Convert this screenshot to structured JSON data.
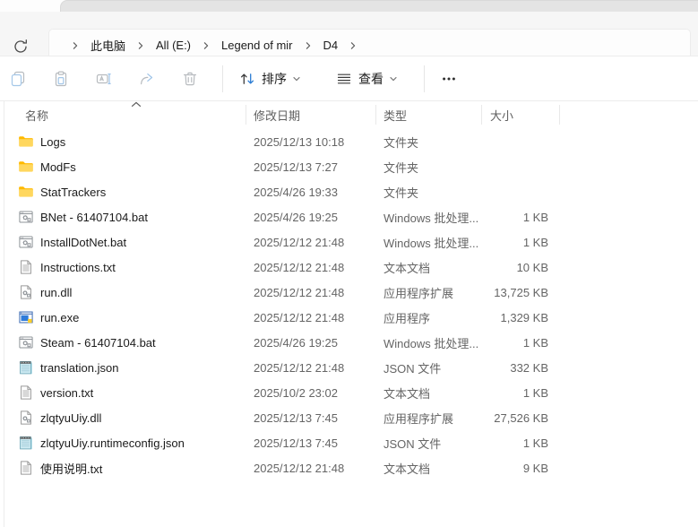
{
  "address_bar": {
    "refresh_icon": "refresh-icon",
    "breadcrumb": {
      "device_icon": "monitor-icon",
      "items": [
        "此电脑",
        "All (E:)",
        "Legend of mir",
        "D4"
      ]
    }
  },
  "toolbar": {
    "icon_buttons": [
      {
        "name": "copy",
        "icon": "copy-icon"
      },
      {
        "name": "paste",
        "icon": "paste-icon"
      },
      {
        "name": "rename",
        "icon": "rename-icon"
      },
      {
        "name": "share",
        "icon": "share-icon"
      },
      {
        "name": "delete",
        "icon": "delete-icon"
      }
    ],
    "sort_label": "排序",
    "view_label": "查看",
    "more_label": "...",
    "accent_color": "#2b7cd3"
  },
  "columns": [
    {
      "id": "name",
      "label": "名称"
    },
    {
      "id": "date-modified",
      "label": "修改日期"
    },
    {
      "id": "type",
      "label": "类型"
    },
    {
      "id": "size",
      "label": "大小"
    }
  ],
  "sort": {
    "column": "名称",
    "direction": "asc"
  },
  "files": [
    {
      "name": "Logs",
      "icon": "folder-icon",
      "date": "2025/12/13 10:18",
      "type": "文件夹",
      "size": ""
    },
    {
      "name": "ModFs",
      "icon": "folder-icon",
      "date": "2025/12/13 7:27",
      "type": "文件夹",
      "size": ""
    },
    {
      "name": "StatTrackers",
      "icon": "folder-icon",
      "date": "2025/4/26 19:33",
      "type": "文件夹",
      "size": ""
    },
    {
      "name": "BNet - 61407104.bat",
      "icon": "batch-file-icon",
      "date": "2025/4/26 19:25",
      "type": "Windows 批处理...",
      "size": "1 KB"
    },
    {
      "name": "InstallDotNet.bat",
      "icon": "batch-file-icon",
      "date": "2025/12/12 21:48",
      "type": "Windows 批处理...",
      "size": "1 KB"
    },
    {
      "name": "Instructions.txt",
      "icon": "text-file-icon",
      "date": "2025/12/12 21:48",
      "type": "文本文档",
      "size": "10 KB"
    },
    {
      "name": "run.dll",
      "icon": "dll-file-icon",
      "date": "2025/12/12 21:48",
      "type": "应用程序扩展",
      "size": "13,725 KB"
    },
    {
      "name": "run.exe",
      "icon": "exe-file-icon",
      "date": "2025/12/12 21:48",
      "type": "应用程序",
      "size": "1,329 KB"
    },
    {
      "name": "Steam - 61407104.bat",
      "icon": "batch-file-icon",
      "date": "2025/4/26 19:25",
      "type": "Windows 批处理...",
      "size": "1 KB"
    },
    {
      "name": "translation.json",
      "icon": "json-file-icon",
      "date": "2025/12/12 21:48",
      "type": "JSON 文件",
      "size": "332 KB"
    },
    {
      "name": "version.txt",
      "icon": "text-file-icon",
      "date": "2025/10/2 23:02",
      "type": "文本文档",
      "size": "1 KB"
    },
    {
      "name": "zlqtyuUiy.dll",
      "icon": "dll-file-icon",
      "date": "2025/12/13 7:45",
      "type": "应用程序扩展",
      "size": "27,526 KB"
    },
    {
      "name": "zlqtyuUiy.runtimeconfig.json",
      "icon": "json-file-icon",
      "date": "2025/12/13 7:45",
      "type": "JSON 文件",
      "size": "1 KB"
    },
    {
      "name": "使用说明.txt",
      "icon": "text-file-icon",
      "date": "2025/12/12 21:48",
      "type": "文本文档",
      "size": "9 KB"
    }
  ]
}
